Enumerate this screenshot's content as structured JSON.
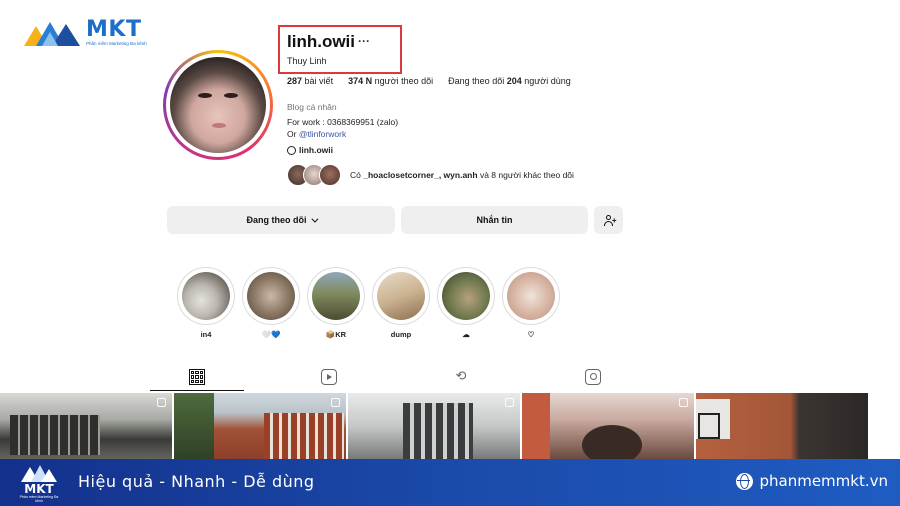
{
  "brand": {
    "name": "MKT",
    "tagline": "Phần mềm Marketing Đa kênh"
  },
  "profile": {
    "username": "linh.owii",
    "more_icon": "···",
    "full_name": "Thuy Linh",
    "posts_count": "287",
    "posts_label": "bài viết",
    "followers_count": "374 N",
    "followers_label": "người theo dõi",
    "following_prefix": "Đang theo dõi",
    "following_count": "204",
    "following_label": "người dùng",
    "bio_category": "Blog cá nhân",
    "bio_line1": "For work : 0368369951 (zalo)",
    "bio_line2_prefix": "Or",
    "bio_mention": "@tlinforwork",
    "threads_handle": "linh.owii",
    "followed_prefix": "Có",
    "followed_users": "_hoaclosetcorner_, wyn.anh",
    "followed_suffix": "và 8 người khác theo dõi"
  },
  "actions": {
    "following_button": "Đang theo dõi",
    "message_button": "Nhắn tin",
    "add_user_icon": "add-user-icon"
  },
  "highlights": [
    {
      "label": "in4"
    },
    {
      "label": "🤍💙"
    },
    {
      "label": "📦KR"
    },
    {
      "label": "dump"
    },
    {
      "label": "☁"
    },
    {
      "label": "♡"
    }
  ],
  "tabs": [
    "posts-grid-icon",
    "reels-icon",
    "reposts-icon",
    "tagged-icon"
  ],
  "footer": {
    "logo_name": "MKT",
    "logo_tagline": "Phần mềm Marketing Đa kênh",
    "slogan": "Hiệu quả - Nhanh  - Dễ dùng",
    "website": "phanmemmkt.vn"
  },
  "colors": {
    "brand_blue": "#1d6ec9",
    "highlight_border": "#d93a3a",
    "button_bg": "#efefef",
    "link": "#3955a5"
  }
}
